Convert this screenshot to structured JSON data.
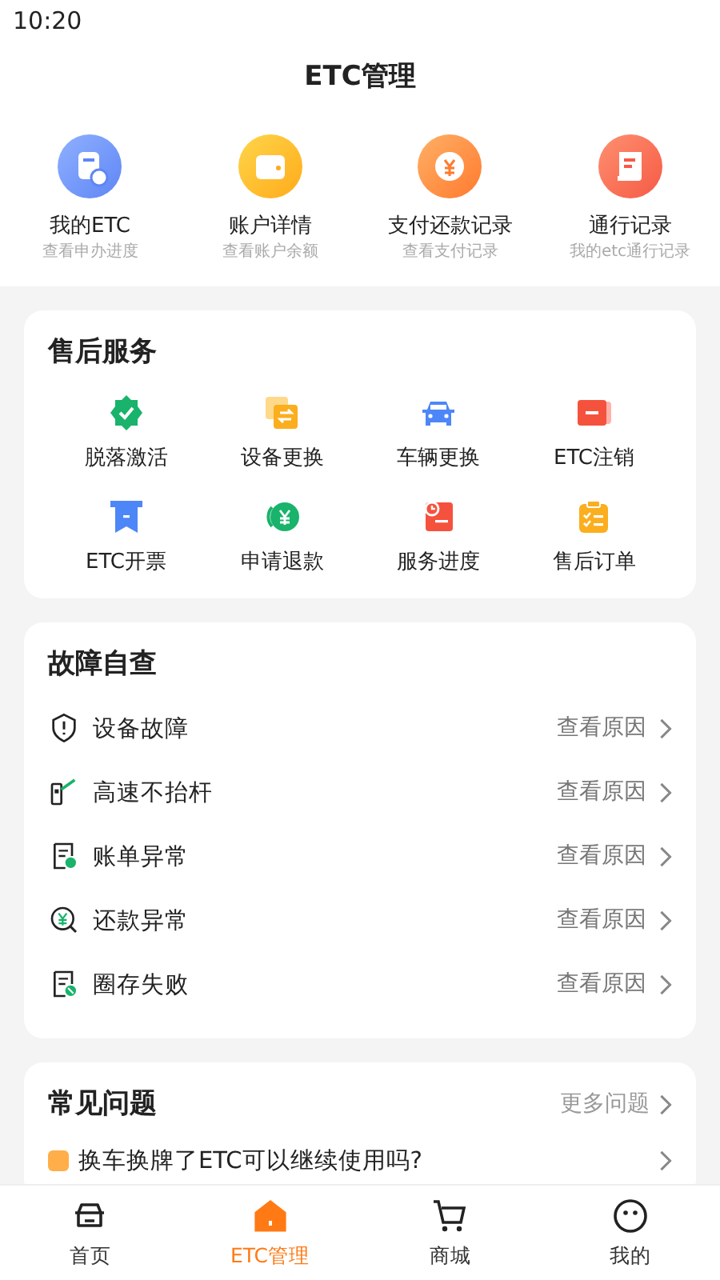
{
  "status_bar": {
    "time": "10:20"
  },
  "header": {
    "title": "ETC管理"
  },
  "quick_links": [
    {
      "label": "我的ETC",
      "subtitle": "查看申办进度"
    },
    {
      "label": "账户详情",
      "subtitle": "查看账户余额"
    },
    {
      "label": "支付还款记录",
      "subtitle": "查看支付记录"
    },
    {
      "label": "通行记录",
      "subtitle": "我的etc通行记录"
    }
  ],
  "after_sales": {
    "title": "售后服务",
    "items": [
      {
        "label": "脱落激活"
      },
      {
        "label": "设备更换"
      },
      {
        "label": "车辆更换"
      },
      {
        "label": "ETC注销"
      },
      {
        "label": "ETC开票"
      },
      {
        "label": "申请退款"
      },
      {
        "label": "服务进度"
      },
      {
        "label": "售后订单"
      }
    ]
  },
  "self_check": {
    "title": "故障自查",
    "rows": [
      {
        "label": "设备故障",
        "action": "查看原因"
      },
      {
        "label": "高速不抬杆",
        "action": "查看原因"
      },
      {
        "label": "账单异常",
        "action": "查看原因"
      },
      {
        "label": "还款异常",
        "action": "查看原因"
      },
      {
        "label": "圈存失败",
        "action": "查看原因"
      }
    ]
  },
  "faq": {
    "title": "常见问题",
    "more": "更多问题",
    "items": [
      {
        "question": "换车换牌了ETC可以继续使用吗?"
      }
    ]
  },
  "tab_bar": [
    {
      "label": "首页",
      "selected": false
    },
    {
      "label": "ETC管理",
      "selected": true
    },
    {
      "label": "商城",
      "selected": false
    },
    {
      "label": "我的",
      "selected": false
    }
  ]
}
